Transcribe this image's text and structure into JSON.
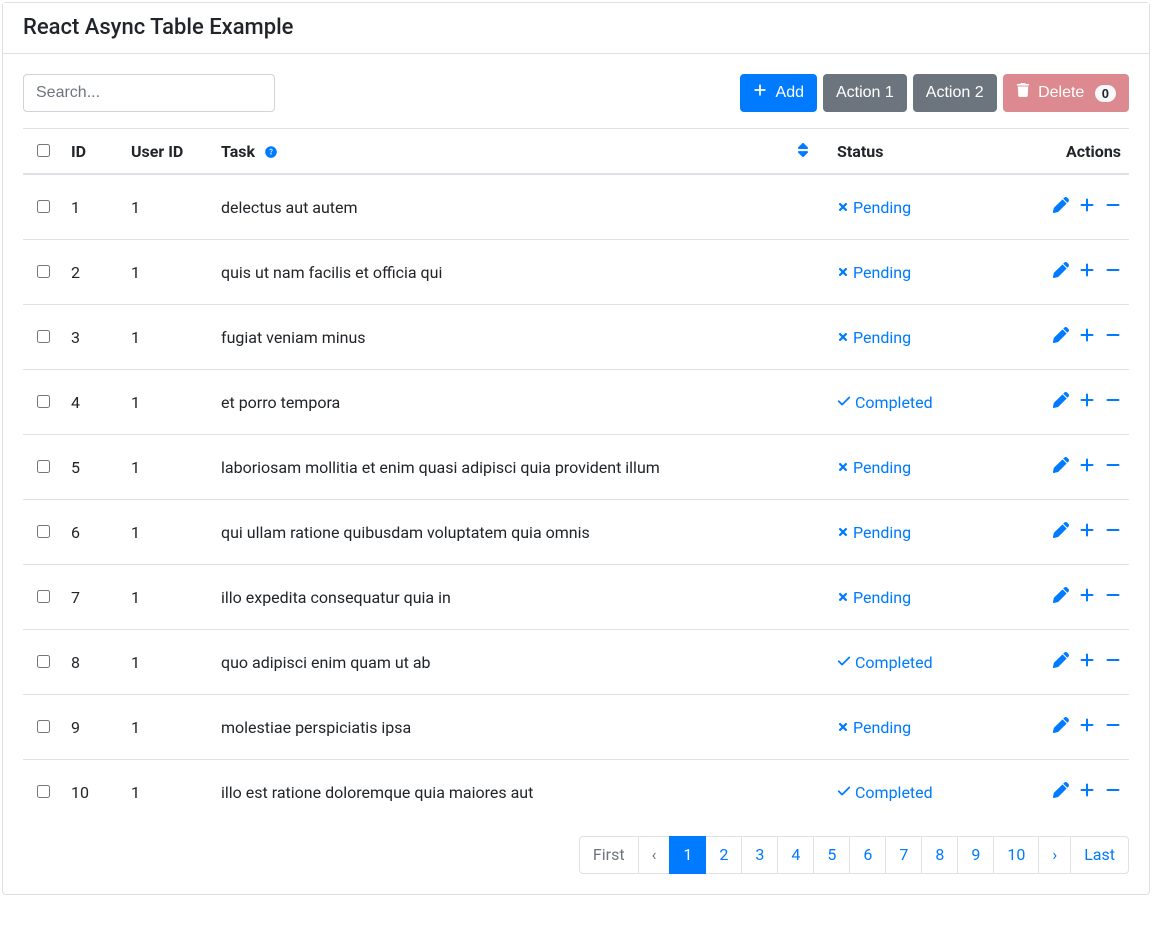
{
  "header": {
    "title": "React Async Table Example"
  },
  "search": {
    "placeholder": "Search...",
    "value": ""
  },
  "toolbar": {
    "add_label": "Add",
    "action1_label": "Action 1",
    "action2_label": "Action 2",
    "delete_label": "Delete",
    "delete_count": "0"
  },
  "columns": {
    "id": "ID",
    "user_id": "User ID",
    "task": "Task",
    "status": "Status",
    "actions": "Actions"
  },
  "status_labels": {
    "pending": "Pending",
    "completed": "Completed"
  },
  "rows": [
    {
      "id": "1",
      "user_id": "1",
      "task": "delectus aut autem",
      "status": "pending"
    },
    {
      "id": "2",
      "user_id": "1",
      "task": "quis ut nam facilis et officia qui",
      "status": "pending"
    },
    {
      "id": "3",
      "user_id": "1",
      "task": "fugiat veniam minus",
      "status": "pending"
    },
    {
      "id": "4",
      "user_id": "1",
      "task": "et porro tempora",
      "status": "completed"
    },
    {
      "id": "5",
      "user_id": "1",
      "task": "laboriosam mollitia et enim quasi adipisci quia provident illum",
      "status": "pending"
    },
    {
      "id": "6",
      "user_id": "1",
      "task": "qui ullam ratione quibusdam voluptatem quia omnis",
      "status": "pending"
    },
    {
      "id": "7",
      "user_id": "1",
      "task": "illo expedita consequatur quia in",
      "status": "pending"
    },
    {
      "id": "8",
      "user_id": "1",
      "task": "quo adipisci enim quam ut ab",
      "status": "completed"
    },
    {
      "id": "9",
      "user_id": "1",
      "task": "molestiae perspiciatis ipsa",
      "status": "pending"
    },
    {
      "id": "10",
      "user_id": "1",
      "task": "illo est ratione doloremque quia maiores aut",
      "status": "completed"
    }
  ],
  "pagination": {
    "first": "First",
    "prev": "‹",
    "next": "›",
    "last": "Last",
    "pages": [
      "1",
      "2",
      "3",
      "4",
      "5",
      "6",
      "7",
      "8",
      "9",
      "10"
    ],
    "active_index": 0,
    "disable_first": true,
    "disable_prev": true
  }
}
